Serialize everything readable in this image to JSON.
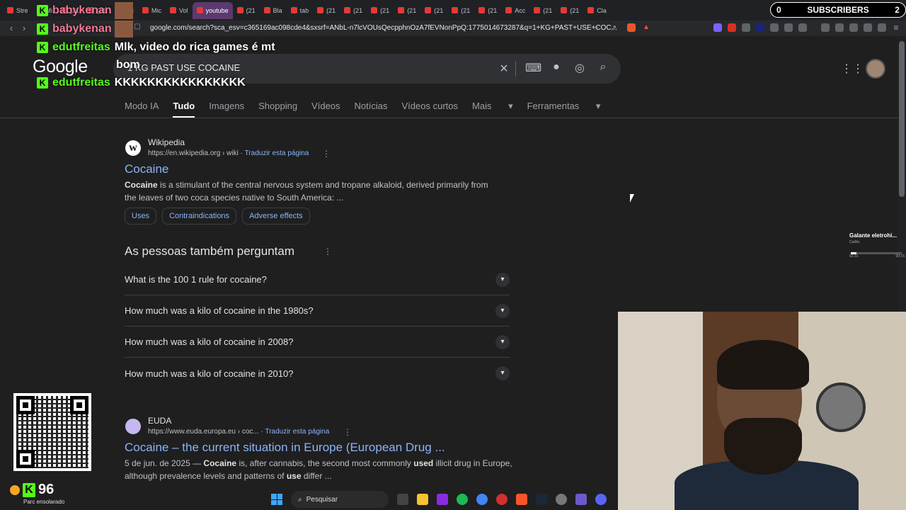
{
  "tabs": [
    {
      "label": "Stre"
    },
    {
      "label": "Mi"
    },
    {
      "label": "(21"
    },
    {
      "label": "(21"
    },
    {
      "label": "Mic"
    },
    {
      "label": "Mic"
    },
    {
      "label": "Vol"
    },
    {
      "label": "youtube"
    },
    {
      "label": "(21"
    },
    {
      "label": "Bla"
    },
    {
      "label": "tab"
    },
    {
      "label": "(21"
    },
    {
      "label": "(21"
    },
    {
      "label": "(21"
    },
    {
      "label": "(21"
    },
    {
      "label": "(21"
    },
    {
      "label": "(21"
    },
    {
      "label": "(21"
    },
    {
      "label": "Acc"
    },
    {
      "label": "(21"
    },
    {
      "label": "(21"
    },
    {
      "label": "Cla"
    }
  ],
  "subscribers": {
    "count_left": "0",
    "label": "SUBSCRIBERS",
    "count_right": "2"
  },
  "address": {
    "url": "google.com/search?sca_esv=c365169ac098cde4&sxsrf=ANbL-n7lcVOUsQecpphnOzA7fEVNonPpQ:1775014673287&q=1+KG+PAST+USE+COC..."
  },
  "chat": [
    {
      "user": "babykenan",
      "text": ""
    },
    {
      "user": "babykenan",
      "text": ""
    },
    {
      "user": "edutfreitas",
      "text": "Mlk, video do rica games é mt"
    },
    {
      "user": "",
      "text": "bom"
    },
    {
      "user": "edutfreitas",
      "text": "KKKKKKKKKKKKKKKK"
    }
  ],
  "google": {
    "logo": "Google",
    "query": "1 KG PAST USE COCAINE",
    "tabs": [
      "Modo IA",
      "Tudo",
      "Imagens",
      "Shopping",
      "Vídeos",
      "Notícias",
      "Vídeos curtos",
      "Mais",
      "Ferramentas"
    ]
  },
  "result1": {
    "site": "Wikipedia",
    "favicon": "W",
    "cite": "https://en.wikipedia.org › wiki",
    "translate": "Traduzir esta página",
    "title": "Cocaine",
    "snippet_bold": "Cocaine",
    "snippet": " is a stimulant of the central nervous system and tropane alkaloid, derived primarily from the leaves of two coca species native to South America: ...",
    "chips": [
      "Uses",
      "Contraindications",
      "Adverse effects"
    ]
  },
  "paa": {
    "heading": "As pessoas também perguntam",
    "questions": [
      "What is the 100 1 rule for cocaine?",
      "How much was a kilo of cocaine in the 1980s?",
      "How much was a kilo of cocaine in 2008?",
      "How much was a kilo of cocaine in 2010?"
    ]
  },
  "result2": {
    "site": "EUDA",
    "cite": "https://www.euda.europa.eu › coc...",
    "translate": "Traduzir esta página",
    "title": "Cocaine – the current situation in Europe (European Drug ...",
    "date": "5 de jun. de 2025 — ",
    "s1": "Cocaine",
    "s2": " is, after cannabis, the second most commonly ",
    "s3": "used",
    "s4": " illicit drug in Europe,",
    "line2a": "although prevalence levels and patterns of ",
    "line2b": "use",
    "line2c": " differ ..."
  },
  "media": {
    "title": "Galante eletrohi...",
    "artist": "Carlito",
    "elapsed": "02:31",
    "total": "00:15"
  },
  "weather": {
    "temp": "96",
    "caption": "Parc ensolarado"
  },
  "taskbar": {
    "search": "Pesquisar"
  }
}
